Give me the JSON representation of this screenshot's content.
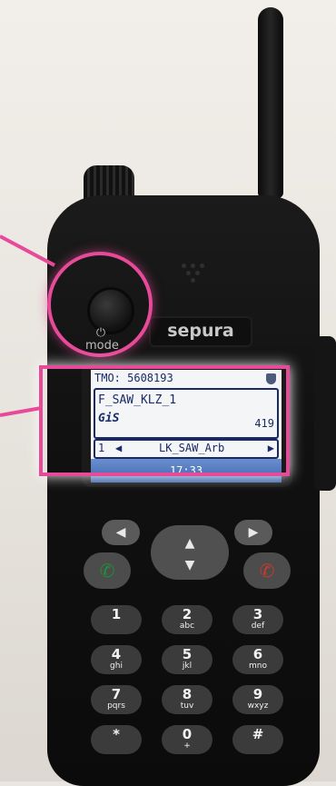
{
  "device": {
    "brand": "sepura",
    "mode_label": "mode",
    "mode_icon": "power-icon"
  },
  "screen": {
    "tmo_line": "TMO: 5608193",
    "group_name": "F_SAW_KLZ_1",
    "gis_label": "GiS",
    "count": "419",
    "talkgroup_number": "1",
    "talkgroup_name": "LK_SAW_Arb",
    "left_arrow": "◀",
    "right_arrow": "▶",
    "time": "17:33"
  },
  "soft_keys": {
    "left": "◀",
    "right": "▶",
    "up": "▲",
    "down": "▼"
  },
  "call_keys": {
    "green": "✆",
    "red": "✆"
  },
  "keypad": [
    {
      "digit": "1",
      "letters": ""
    },
    {
      "digit": "2",
      "letters": "abc"
    },
    {
      "digit": "3",
      "letters": "def"
    },
    {
      "digit": "4",
      "letters": "ghi"
    },
    {
      "digit": "5",
      "letters": "jkl"
    },
    {
      "digit": "6",
      "letters": "mno"
    },
    {
      "digit": "7",
      "letters": "pqrs"
    },
    {
      "digit": "8",
      "letters": "tuv"
    },
    {
      "digit": "9",
      "letters": "wxyz"
    },
    {
      "digit": "*",
      "letters": ""
    },
    {
      "digit": "0",
      "letters": "+"
    },
    {
      "digit": "#",
      "letters": ""
    }
  ],
  "colors": {
    "highlight": "#e84a9a",
    "screen_text": "#1a2a66",
    "call_green": "#1f8f3a",
    "call_red": "#c93a2a"
  }
}
